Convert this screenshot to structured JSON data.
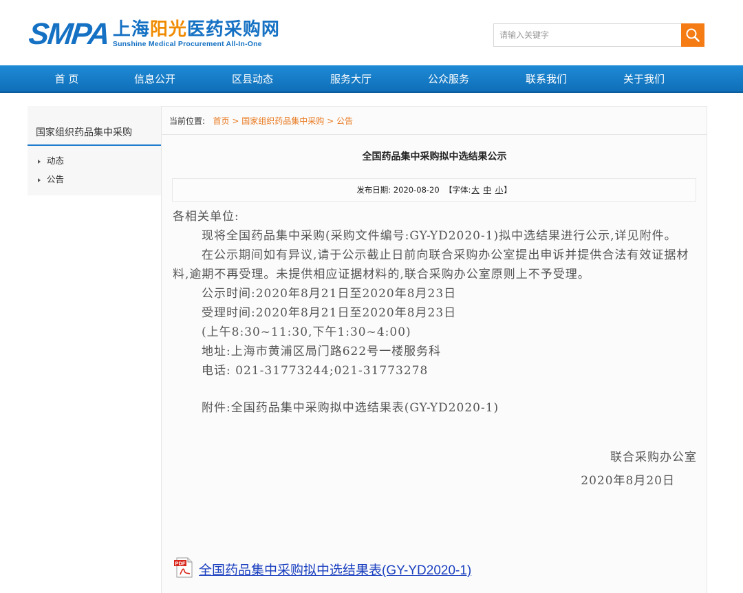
{
  "header": {
    "logo_mark": "SMPA",
    "logo_cn_1": "上海",
    "logo_cn_2": "阳光",
    "logo_cn_3": "医药采购网",
    "logo_en": "Sunshine Medical Procurement All-In-One",
    "search_placeholder": "请输入关键字",
    "brand_blue": "#1571c3",
    "brand_orange": "#f08a00"
  },
  "nav": {
    "items": [
      "首 页",
      "信息公开",
      "区县动态",
      "服务大厅",
      "公众服务",
      "联系我们",
      "关于我们"
    ]
  },
  "sidebar": {
    "title": "国家组织药品集中采购",
    "items": [
      "动态",
      "公告"
    ]
  },
  "breadcrumb": {
    "label": "当前位置:",
    "items": [
      "首页",
      "国家组织药品集中采购",
      "公告"
    ],
    "separator": ">"
  },
  "article": {
    "title": "全国药品集中采购拟中选结果公示",
    "date_label": "发布日期:",
    "date": "2020-08-20",
    "font_label_open": "【字体:",
    "font_large": "大",
    "font_medium": "中",
    "font_small": "小",
    "font_label_close": "】",
    "salutation": "各相关单位:",
    "para1": "现将全国药品集中采购(采购文件编号:GY-YD2020-1)拟中选结果进行公示,详见附件。",
    "para2": "在公示期间如有异议,请于公示截止日前向联合采购办公室提出申诉并提供合法有效证据材料,逾期不再受理。未提供相应证据材料的,联合采购办公室原则上不予受理。",
    "notice_time": "公示时间:2020年8月21日至2020年8月23日",
    "accept_time": "受理时间:2020年8月21日至2020年8月23日",
    "hours": "(上午8:30~11:30,下午1:30~4:00)",
    "address": "地址:上海市黄浦区局门路622号一楼服务科",
    "phone": "电话: 021-31773244;021-31773278",
    "attachment_note": "附件:全国药品集中采购拟中选结果表(GY-YD2020-1)",
    "signature_org": "联合采购办公室",
    "signature_date": "2020年8月20日"
  },
  "attachment": {
    "icon": "pdf-icon",
    "icon_text": "PDF",
    "link_text": "全国药品集中采购拟中选结果表(GY-YD2020-1)"
  }
}
